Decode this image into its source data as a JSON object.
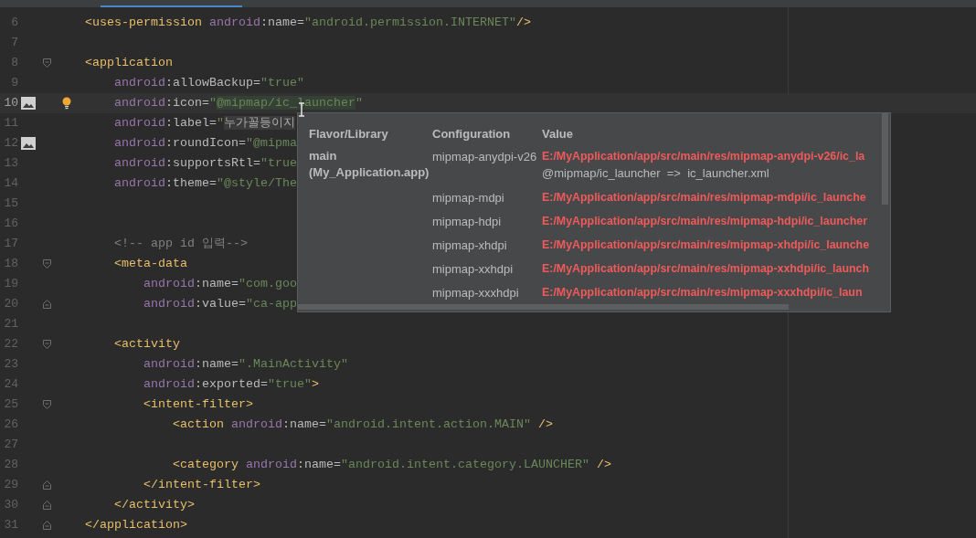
{
  "editor": {
    "lines": [
      {
        "number": "6",
        "tokens": [
          {
            "kind": "tag",
            "text": "    <uses-permission "
          },
          {
            "kind": "ns",
            "text": "android"
          },
          {
            "kind": "attr",
            "text": ":name="
          },
          {
            "kind": "str",
            "text": "\"android.permission.INTERNET\""
          },
          {
            "kind": "tag",
            "text": "/>"
          }
        ]
      },
      {
        "number": "7"
      },
      {
        "number": "8",
        "fold_start": true,
        "tokens": [
          {
            "kind": "tag",
            "text": "    <application"
          }
        ]
      },
      {
        "number": "9",
        "tokens": [
          {
            "kind": "ns",
            "text": "        android"
          },
          {
            "kind": "attr",
            "text": ":allowBackup="
          },
          {
            "kind": "str",
            "text": "\"true\""
          }
        ]
      },
      {
        "number": "10",
        "current": true,
        "image_marker": true,
        "intention_bulb": true,
        "tokens": [
          {
            "kind": "ns",
            "text": "        android"
          },
          {
            "kind": "attr",
            "text": ":icon="
          },
          {
            "kind": "str",
            "text": "\""
          },
          {
            "kind": "hl",
            "text": "@mipmap/ic_launcher"
          },
          {
            "kind": "str",
            "text": "\""
          }
        ]
      },
      {
        "number": "11",
        "tokens": [
          {
            "kind": "ns",
            "text": "        android"
          },
          {
            "kind": "attr",
            "text": ":label="
          },
          {
            "kind": "str",
            "text": "\""
          },
          {
            "kind": "folded",
            "text": "누가꼴등이지"
          }
        ]
      },
      {
        "number": "12",
        "image_marker": true,
        "tokens": [
          {
            "kind": "ns",
            "text": "        android"
          },
          {
            "kind": "attr",
            "text": ":roundIcon="
          },
          {
            "kind": "str",
            "text": "\"@mipma"
          }
        ]
      },
      {
        "number": "13",
        "tokens": [
          {
            "kind": "ns",
            "text": "        android"
          },
          {
            "kind": "attr",
            "text": ":supportsRtl="
          },
          {
            "kind": "str",
            "text": "\"true"
          }
        ]
      },
      {
        "number": "14",
        "tokens": [
          {
            "kind": "ns",
            "text": "        android"
          },
          {
            "kind": "attr",
            "text": ":theme="
          },
          {
            "kind": "str",
            "text": "\"@style/The"
          }
        ]
      },
      {
        "number": "15"
      },
      {
        "number": "16"
      },
      {
        "number": "17",
        "tokens": [
          {
            "kind": "comment",
            "text": "        <!-- app id 입력-->"
          }
        ]
      },
      {
        "number": "18",
        "fold_start": true,
        "tokens": [
          {
            "kind": "tag",
            "text": "        <meta-data"
          }
        ]
      },
      {
        "number": "19",
        "tokens": [
          {
            "kind": "ns",
            "text": "            android"
          },
          {
            "kind": "attr",
            "text": ":name="
          },
          {
            "kind": "str",
            "text": "\"com.goo"
          }
        ]
      },
      {
        "number": "20",
        "fold_end": true,
        "tokens": [
          {
            "kind": "ns",
            "text": "            android"
          },
          {
            "kind": "attr",
            "text": ":value="
          },
          {
            "kind": "str",
            "text": "\"ca-app"
          }
        ]
      },
      {
        "number": "21"
      },
      {
        "number": "22",
        "fold_start": true,
        "tokens": [
          {
            "kind": "tag",
            "text": "        <activity"
          }
        ]
      },
      {
        "number": "23",
        "tokens": [
          {
            "kind": "ns",
            "text": "            android"
          },
          {
            "kind": "attr",
            "text": ":name="
          },
          {
            "kind": "str",
            "text": "\".MainActivity\""
          }
        ]
      },
      {
        "number": "24",
        "tokens": [
          {
            "kind": "ns",
            "text": "            android"
          },
          {
            "kind": "attr",
            "text": ":exported="
          },
          {
            "kind": "str",
            "text": "\"true\""
          },
          {
            "kind": "tag",
            "text": ">"
          }
        ]
      },
      {
        "number": "25",
        "fold_start": true,
        "tokens": [
          {
            "kind": "tag",
            "text": "            <intent-filter>"
          }
        ]
      },
      {
        "number": "26",
        "tokens": [
          {
            "kind": "tag",
            "text": "                <action "
          },
          {
            "kind": "ns",
            "text": "android"
          },
          {
            "kind": "attr",
            "text": ":name="
          },
          {
            "kind": "str",
            "text": "\"android.intent.action.MAIN\""
          },
          {
            "kind": "tag",
            "text": " />"
          }
        ]
      },
      {
        "number": "27"
      },
      {
        "number": "28",
        "tokens": [
          {
            "kind": "tag",
            "text": "                <category "
          },
          {
            "kind": "ns",
            "text": "android"
          },
          {
            "kind": "attr",
            "text": ":name="
          },
          {
            "kind": "str",
            "text": "\"android.intent.category.LAUNCHER\""
          },
          {
            "kind": "tag",
            "text": " />"
          }
        ]
      },
      {
        "number": "29",
        "fold_end": true,
        "tokens": [
          {
            "kind": "tag",
            "text": "            </intent-filter>"
          }
        ]
      },
      {
        "number": "30",
        "fold_end": true,
        "tokens": [
          {
            "kind": "tag",
            "text": "        </activity>"
          }
        ]
      },
      {
        "number": "31",
        "fold_end": true,
        "tokens": [
          {
            "kind": "tag",
            "text": "    </application>"
          }
        ]
      }
    ]
  },
  "popup": {
    "columns": [
      "Flavor/Library",
      "Configuration",
      "Value"
    ],
    "rows": [
      {
        "flavor": "main (My_Application.app)",
        "configuration": "mipmap-anydpi-v26",
        "value": "E:/MyApplication/app/src/main/res/mipmap-anydpi-v26/ic_la",
        "note": "@mipmap/ic_launcher  =>  ic_launcher.xml"
      },
      {
        "configuration": "mipmap-mdpi",
        "value": "E:/MyApplication/app/src/main/res/mipmap-mdpi/ic_launche"
      },
      {
        "configuration": "mipmap-hdpi",
        "value": "E:/MyApplication/app/src/main/res/mipmap-hdpi/ic_launcher"
      },
      {
        "configuration": "mipmap-xhdpi",
        "value": "E:/MyApplication/app/src/main/res/mipmap-xhdpi/ic_launche"
      },
      {
        "configuration": "mipmap-xxhdpi",
        "value": "E:/MyApplication/app/src/main/res/mipmap-xxhdpi/ic_launch"
      },
      {
        "configuration": "mipmap-xxxhdpi",
        "value": "E:/MyApplication/app/src/main/res/mipmap-xxxhdpi/ic_laun"
      }
    ]
  }
}
